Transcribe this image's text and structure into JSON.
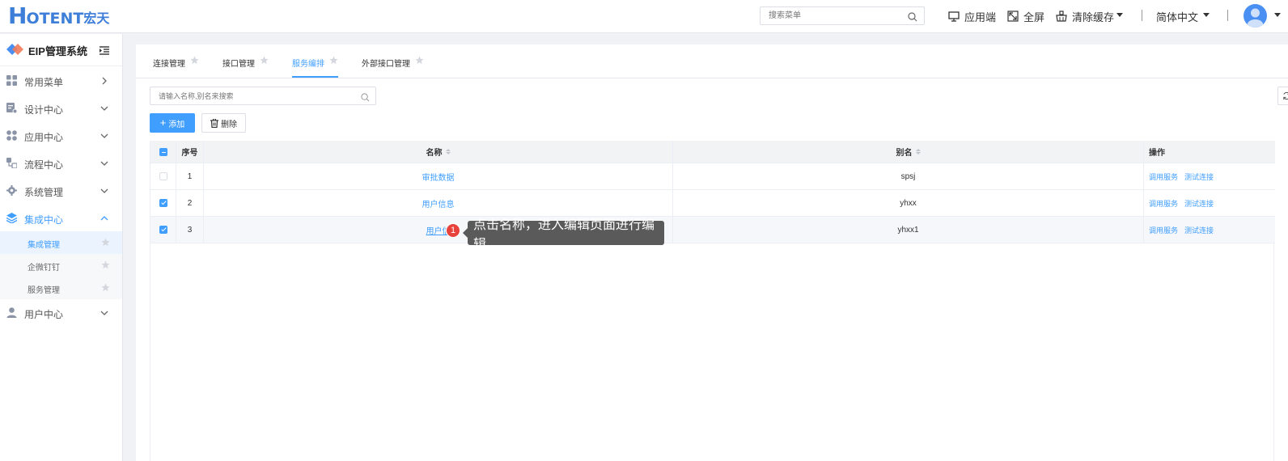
{
  "header": {
    "logo_h": "H",
    "logo_rest": "OTENT",
    "logo_cn": "宏天",
    "search_placeholder": "搜索菜单",
    "app_end": "应用端",
    "fullscreen": "全屏",
    "clear_cache": "清除缓存",
    "language": "简体中文"
  },
  "sidebar": {
    "system_title": "EIP管理系统",
    "menu": [
      {
        "label": "常用菜单",
        "icon": "grid-icon"
      },
      {
        "label": "设计中心",
        "icon": "design-icon"
      },
      {
        "label": "应用中心",
        "icon": "apps-icon"
      },
      {
        "label": "流程中心",
        "icon": "flow-icon"
      },
      {
        "label": "系统管理",
        "icon": "gear-icon"
      },
      {
        "label": "集成中心",
        "icon": "layers-icon"
      },
      {
        "label": "用户中心",
        "icon": "user-icon"
      }
    ],
    "submenu": [
      {
        "label": "集成管理"
      },
      {
        "label": "企微钉钉"
      },
      {
        "label": "服务管理"
      }
    ]
  },
  "tabs": [
    {
      "label": "连接管理"
    },
    {
      "label": "接口管理"
    },
    {
      "label": "服务编排"
    },
    {
      "label": "外部接口管理"
    }
  ],
  "toolbar": {
    "search_placeholder": "请输入名称,别名来搜索",
    "add_label": "添加",
    "delete_label": "删除"
  },
  "table": {
    "columns": {
      "index": "序号",
      "name": "名称",
      "alias": "别名",
      "ops": "操作"
    },
    "rows": [
      {
        "index": "1",
        "name": "审批数据",
        "alias": "spsj",
        "op1": "调用服务",
        "op2": "测试连接"
      },
      {
        "index": "2",
        "name": "用户信息",
        "alias": "yhxx",
        "op1": "调用服务",
        "op2": "测试连接"
      },
      {
        "index": "3",
        "name": "用户信",
        "alias": "yhxx1",
        "op1": "调用服务",
        "op2": "测试连接"
      }
    ]
  },
  "guide": {
    "step": "1",
    "text": "点击名称，进入编辑页面进行编辑"
  },
  "colors": {
    "primary": "#409eff",
    "badge": "#e8423c",
    "tooltip": "#5a5a5a"
  }
}
